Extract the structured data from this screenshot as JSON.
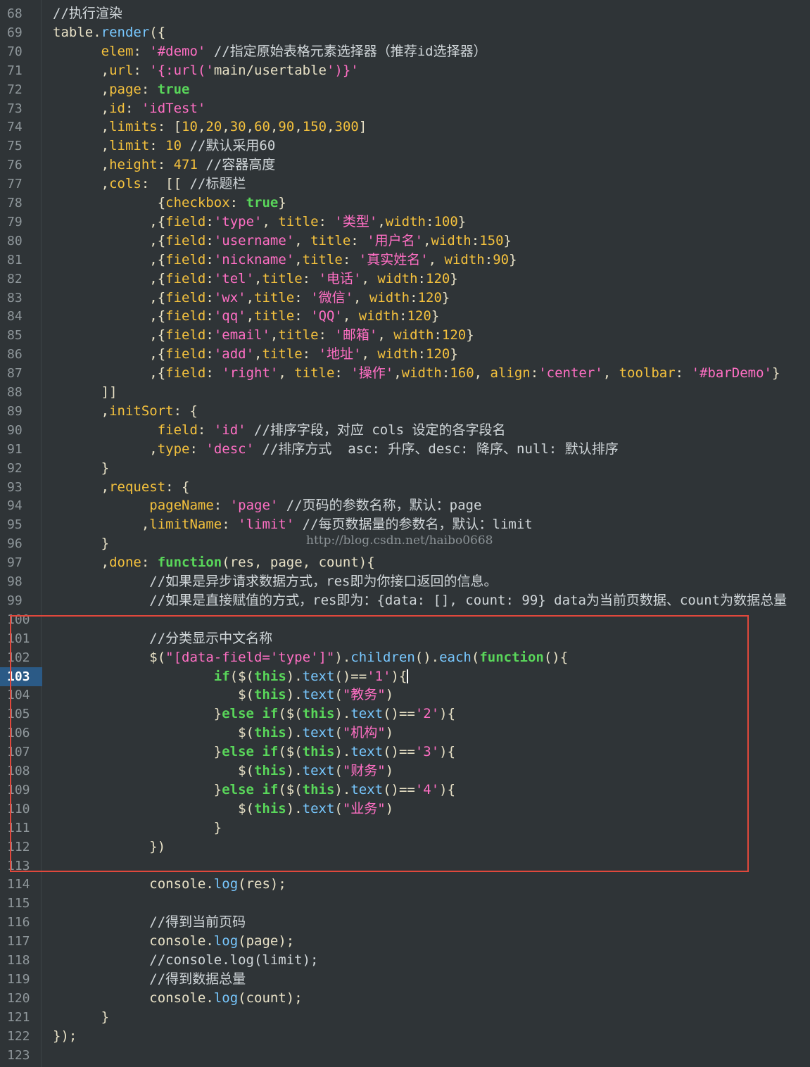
{
  "watermark": "http://blog.csdn.net/haibo0668",
  "colors": {
    "background": "#2f3437",
    "comment": "#d0d6d9",
    "string": "#ff6fc4",
    "keyword": "#59d65a",
    "number": "#f4c13d",
    "function": "#78c8ff",
    "highlight_box": "#e0483c",
    "active_line": "#2b5a86"
  },
  "editor": {
    "active_line": "103",
    "lines": [
      {
        "n": "68",
        "t": "//执行渲染"
      },
      {
        "n": "69",
        "t": "table.render({"
      },
      {
        "n": "70",
        "t": "      elem: '#demo' //指定原始表格元素选择器（推荐id选择器）"
      },
      {
        "n": "71",
        "t": "      ,url: '{:url('main/usertable')}'"
      },
      {
        "n": "72",
        "t": "      ,page: true"
      },
      {
        "n": "73",
        "t": "      ,id: 'idTest'"
      },
      {
        "n": "74",
        "t": "      ,limits: [10,20,30,60,90,150,300]"
      },
      {
        "n": "75",
        "t": "      ,limit: 10 //默认采用60"
      },
      {
        "n": "76",
        "t": "      ,height: 471 //容器高度"
      },
      {
        "n": "77",
        "t": "      ,cols:  [[ //标题栏"
      },
      {
        "n": "78",
        "t": "             {checkbox: true}"
      },
      {
        "n": "79",
        "t": "            ,{field:'type', title: '类型',width:100}"
      },
      {
        "n": "80",
        "t": "            ,{field:'username', title: '用户名',width:150}"
      },
      {
        "n": "81",
        "t": "            ,{field:'nickname',title: '真实姓名', width:90}"
      },
      {
        "n": "82",
        "t": "            ,{field:'tel',title: '电话', width:120}"
      },
      {
        "n": "83",
        "t": "            ,{field:'wx',title: '微信', width:120}"
      },
      {
        "n": "84",
        "t": "            ,{field:'qq',title: 'QQ', width:120}"
      },
      {
        "n": "85",
        "t": "            ,{field:'email',title: '邮箱', width:120}"
      },
      {
        "n": "86",
        "t": "            ,{field:'add',title: '地址', width:120}"
      },
      {
        "n": "87",
        "t": "            ,{field: 'right', title: '操作',width:160, align:'center', toolbar: '#barDemo'}"
      },
      {
        "n": "88",
        "t": "      ]]"
      },
      {
        "n": "89",
        "t": "      ,initSort: {"
      },
      {
        "n": "90",
        "t": "             field: 'id' //排序字段，对应 cols 设定的各字段名"
      },
      {
        "n": "91",
        "t": "            ,type: 'desc' //排序方式  asc: 升序、desc: 降序、null: 默认排序"
      },
      {
        "n": "92",
        "t": "      }"
      },
      {
        "n": "93",
        "t": "      ,request: {"
      },
      {
        "n": "94",
        "t": "            pageName: 'page' //页码的参数名称，默认：page"
      },
      {
        "n": "95",
        "t": "           ,limitName: 'limit' //每页数据量的参数名，默认：limit"
      },
      {
        "n": "96",
        "t": "      }"
      },
      {
        "n": "97",
        "t": "      ,done: function(res, page, count){"
      },
      {
        "n": "98",
        "t": "            //如果是异步请求数据方式，res即为你接口返回的信息。"
      },
      {
        "n": "99",
        "t": "            //如果是直接赋值的方式，res即为：{data: [], count: 99} data为当前页数据、count为数据总量"
      },
      {
        "n": "100",
        "t": ""
      },
      {
        "n": "101",
        "t": "            //分类显示中文名称"
      },
      {
        "n": "102",
        "t": "            $(\"[data-field='type']\").children().each(function(){"
      },
      {
        "n": "103",
        "t": "                    if($(this).text()=='1'){"
      },
      {
        "n": "104",
        "t": "                       $(this).text(\"教务\")"
      },
      {
        "n": "105",
        "t": "                    }else if($(this).text()=='2'){"
      },
      {
        "n": "106",
        "t": "                       $(this).text(\"机构\")"
      },
      {
        "n": "107",
        "t": "                    }else if($(this).text()=='3'){"
      },
      {
        "n": "108",
        "t": "                       $(this).text(\"财务\")"
      },
      {
        "n": "109",
        "t": "                    }else if($(this).text()=='4'){"
      },
      {
        "n": "110",
        "t": "                       $(this).text(\"业务\")"
      },
      {
        "n": "111",
        "t": "                    }"
      },
      {
        "n": "112",
        "t": "            })"
      },
      {
        "n": "113",
        "t": ""
      },
      {
        "n": "114",
        "t": "            console.log(res);"
      },
      {
        "n": "115",
        "t": ""
      },
      {
        "n": "116",
        "t": "            //得到当前页码"
      },
      {
        "n": "117",
        "t": "            console.log(page);"
      },
      {
        "n": "118",
        "t": "            //console.log(limit);"
      },
      {
        "n": "119",
        "t": "            //得到数据总量"
      },
      {
        "n": "120",
        "t": "            console.log(count);"
      },
      {
        "n": "121",
        "t": "      }"
      },
      {
        "n": "122",
        "t": "});"
      },
      {
        "n": "123",
        "t": ""
      }
    ]
  }
}
